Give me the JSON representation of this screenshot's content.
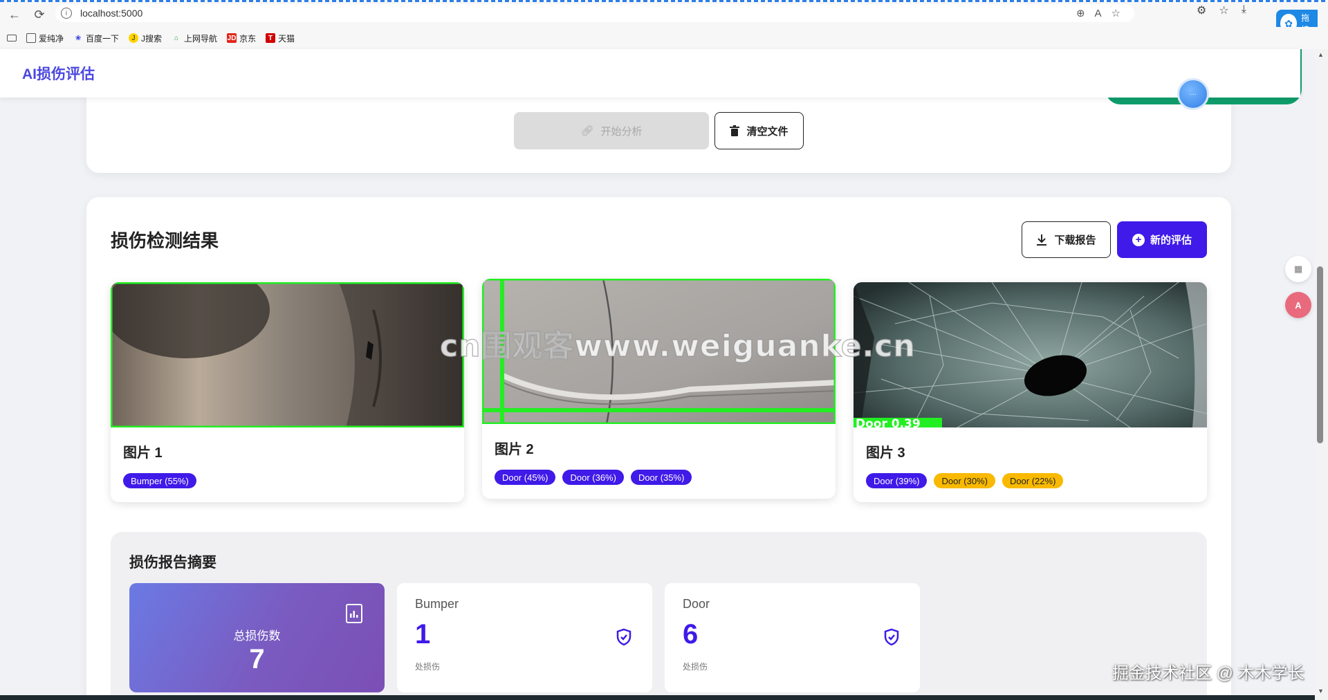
{
  "browser": {
    "url": "localhost:5000",
    "bookmarks": [
      {
        "label": "爱纯净"
      },
      {
        "label": "百度一下"
      },
      {
        "label": "J搜索"
      },
      {
        "label": "上网导航"
      },
      {
        "label": "京东"
      },
      {
        "label": "天猫"
      }
    ],
    "extension_label": "拖拽:"
  },
  "app": {
    "brand": "AI损伤评估"
  },
  "upload": {
    "start_label": "开始分析",
    "clear_label": "清空文件"
  },
  "results": {
    "title": "损伤检测结果",
    "download_label": "下载报告",
    "new_label": "新的评估",
    "images": [
      {
        "title": "图片 1",
        "tags": [
          {
            "text": "Bumper (55%)",
            "color": "blue"
          }
        ]
      },
      {
        "title": "图片 2",
        "tags": [
          {
            "text": "Door (45%)",
            "color": "blue"
          },
          {
            "text": "Door (36%)",
            "color": "blue"
          },
          {
            "text": "Door (35%)",
            "color": "blue"
          }
        ]
      },
      {
        "title": "图片 3",
        "overlay_label": "Door 0.39",
        "tags": [
          {
            "text": "Door (39%)",
            "color": "blue"
          },
          {
            "text": "Door (30%)",
            "color": "yellow"
          },
          {
            "text": "Door (22%)",
            "color": "yellow"
          }
        ]
      }
    ]
  },
  "summary": {
    "title": "损伤报告摘要",
    "total_label": "总损伤数",
    "total_value": "7",
    "stats": [
      {
        "name": "Bumper",
        "value": "1",
        "unit": "处损伤"
      },
      {
        "name": "Door",
        "value": "6",
        "unit": "处损伤"
      }
    ]
  },
  "overlays": {
    "watermark": "cn围观客www.weiguanke.cn",
    "credit": "掘金技术社区 @ 木木学长"
  },
  "colors": {
    "accent": "#3f1ae8",
    "brand": "#4a47e0",
    "warning_tag": "#f8b900",
    "detection_box": "#22ee22"
  }
}
